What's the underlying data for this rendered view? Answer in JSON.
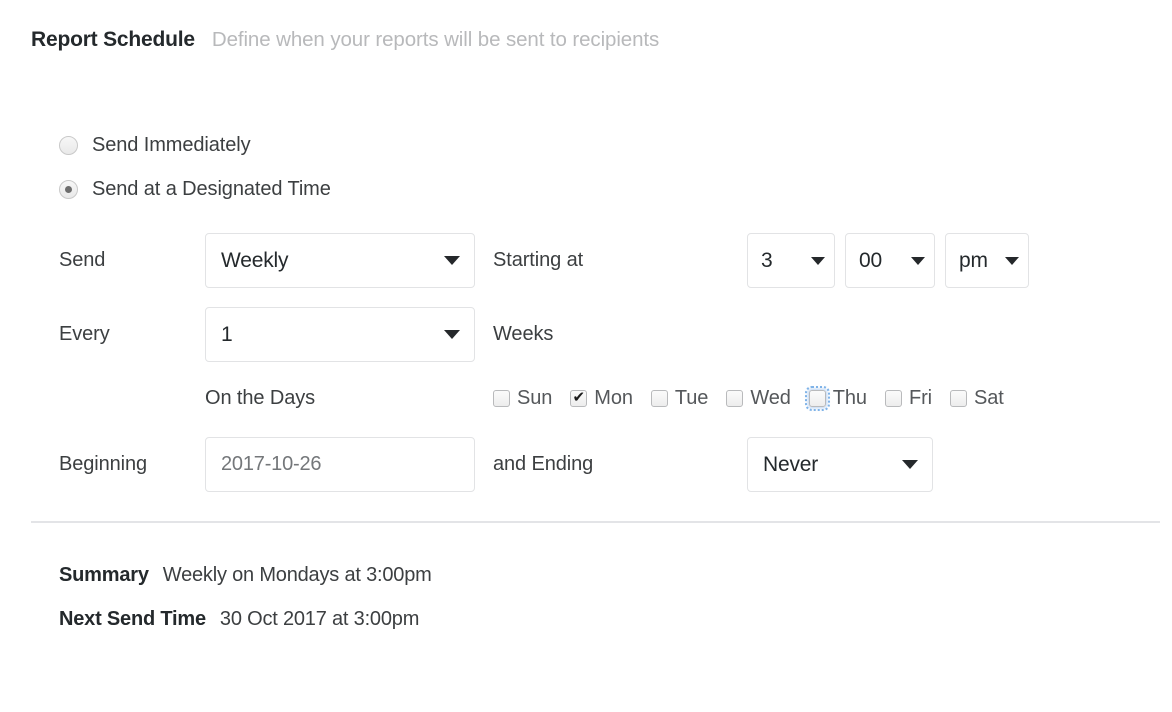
{
  "header": {
    "title": "Report Schedule",
    "subtitle": "Define when your reports will be sent to recipients"
  },
  "send_mode": {
    "options": [
      {
        "label": "Send Immediately",
        "selected": false
      },
      {
        "label": "Send at a Designated Time",
        "selected": true
      }
    ]
  },
  "schedule": {
    "send_label": "Send",
    "frequency_value": "Weekly",
    "starting_at_label": "Starting at",
    "hour_value": "3",
    "minute_value": "00",
    "ampm_value": "pm",
    "every_label": "Every",
    "interval_value": "1",
    "interval_unit_label": "Weeks",
    "on_the_days_label": "On the Days",
    "days": [
      {
        "label": "Sun",
        "checked": false,
        "focused": false
      },
      {
        "label": "Mon",
        "checked": true,
        "focused": false
      },
      {
        "label": "Tue",
        "checked": false,
        "focused": false
      },
      {
        "label": "Wed",
        "checked": false,
        "focused": false
      },
      {
        "label": "Thu",
        "checked": false,
        "focused": true
      },
      {
        "label": "Fri",
        "checked": false,
        "focused": false
      },
      {
        "label": "Sat",
        "checked": false,
        "focused": false
      }
    ],
    "beginning_label": "Beginning",
    "beginning_value": "2017-10-26",
    "beginning_placeholder": "2017-10-26",
    "and_ending_label": "and Ending",
    "ending_value": "Never"
  },
  "summary": {
    "summary_label": "Summary",
    "summary_value": "Weekly on Mondays at 3:00pm",
    "next_send_label": "Next Send Time",
    "next_send_value": "30 Oct 2017 at 3:00pm"
  },
  "colors": {
    "text_primary": "#24292c",
    "text_secondary": "#3c3f41",
    "text_muted": "#b8b9bb",
    "border": "#e2e3e5",
    "divider": "#e3e4e7",
    "focus_ring": "#7fb3e8"
  }
}
